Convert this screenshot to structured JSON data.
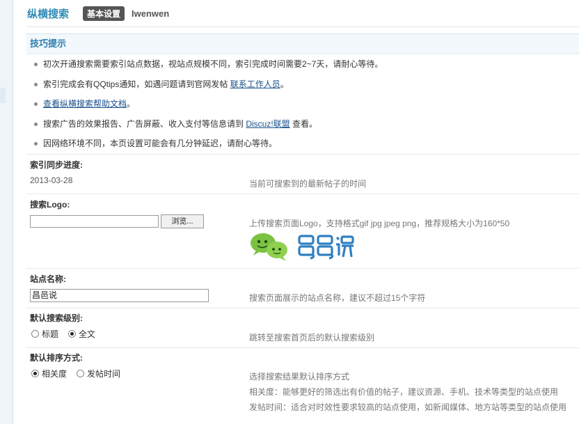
{
  "header": {
    "title": "纵横搜索",
    "tab_label": "基本设置",
    "user": "Iwenwen"
  },
  "tips": {
    "title": "技巧提示",
    "items": [
      {
        "text": "初次开通搜索需要索引站点数据，视站点规模不同，索引完成时间需要2~7天，请耐心等待。"
      },
      {
        "pre": "索引完成会有QQtips通知，如遇问题请到官网发帖 ",
        "link": "联系工作人员",
        "post": "。"
      },
      {
        "pre": " ",
        "link": "查看纵横搜索帮助文档",
        "post": "。"
      },
      {
        "pre": "搜索广告的效果报告、广告屏蔽、收入支付等信息请到  ",
        "link": "Discuz!联盟",
        "post": "  查看。"
      },
      {
        "text": "因网络环境不同，本页设置可能会有几分钟延迟，请耐心等待。"
      }
    ]
  },
  "progress": {
    "label": "索引同步进度:",
    "value": "2013-03-28",
    "desc": "当前可搜索到的最新帖子的时间"
  },
  "logo": {
    "label": "搜索Logo:",
    "file_value": "",
    "browse_label": "浏览...",
    "desc": "上传搜索页面Logo，支持格式gif jpg jpeg png，推荐规格大小为160*50",
    "brand_text": "邑邑说"
  },
  "site": {
    "label": "站点名称:",
    "value": "昌邑说",
    "desc": "搜索页面展示的站点名称，建议不超过15个字符"
  },
  "level": {
    "label": "默认搜索级别:",
    "options": [
      {
        "label": "标题",
        "checked": false
      },
      {
        "label": "全文",
        "checked": true
      }
    ],
    "desc": "跳转至搜索首页后的默认搜索级别"
  },
  "sort": {
    "label": "默认排序方式:",
    "options": [
      {
        "label": "相关度",
        "checked": true
      },
      {
        "label": "发帖时间",
        "checked": false
      }
    ],
    "desc": "选择搜索结果默认排序方式",
    "desc2": "相关度：能够更好的筛选出有价值的帖子，建议资源、手机、技术等类型的站点使用",
    "desc3": "发帖时间：适合对时效性要求较高的站点使用，如新闻媒体、地方站等类型的站点使用"
  },
  "colors": {
    "accent": "#2f8bb5",
    "link": "#1a4f8a",
    "tip_bg": "#f2f8fb",
    "logo_green": "#7cc242",
    "logo_blue": "#2f7fc1"
  }
}
